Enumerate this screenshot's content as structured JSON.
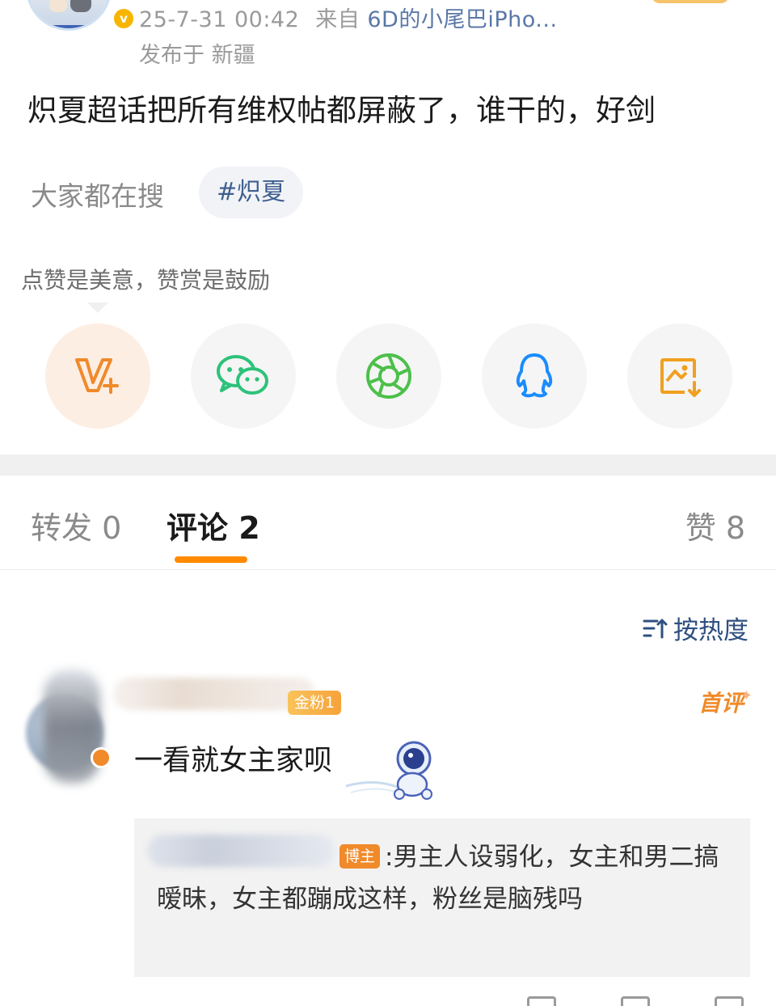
{
  "post": {
    "timestamp": "25-7-31 00:42",
    "source_prefix": "来自",
    "source_device": "6D的小尾巴iPho...",
    "published_at": "发布于 新疆",
    "verified_badge": "v",
    "text": "炽夏超话把所有维权帖都屏蔽了，谁干的，好剑"
  },
  "search": {
    "label": "大家都在搜",
    "topic": "#炽夏"
  },
  "tip": "点赞是美意，赞赏是鼓励",
  "share_row": [
    {
      "icon": "reward-v-plus-icon",
      "color": "#f08a2a"
    },
    {
      "icon": "wechat-icon",
      "color": "#2dc27a"
    },
    {
      "icon": "moments-icon",
      "color": "#4cc04a"
    },
    {
      "icon": "qq-icon",
      "color": "#1a8cff"
    },
    {
      "icon": "save-image-icon",
      "color": "#f0a020"
    }
  ],
  "tabs": {
    "repost": "转发 0",
    "comments": "评论 2",
    "likes": "赞 8"
  },
  "sort": {
    "label": "按热度",
    "icon": "sort-icon"
  },
  "comment": {
    "fan_badge": "金粉1",
    "first_label": "首评",
    "text": "一看就女主家呗",
    "reply": {
      "author_badge": "博主",
      "text": ":男主人设弱化，女主和男二搞暧昧，女主都蹦成这样，粉丝是脑残吗"
    }
  },
  "colors": {
    "accent": "#ff8a00",
    "link": "#5a78a8",
    "topic": "#3e5f8f",
    "muted": "#9a9a9a"
  }
}
